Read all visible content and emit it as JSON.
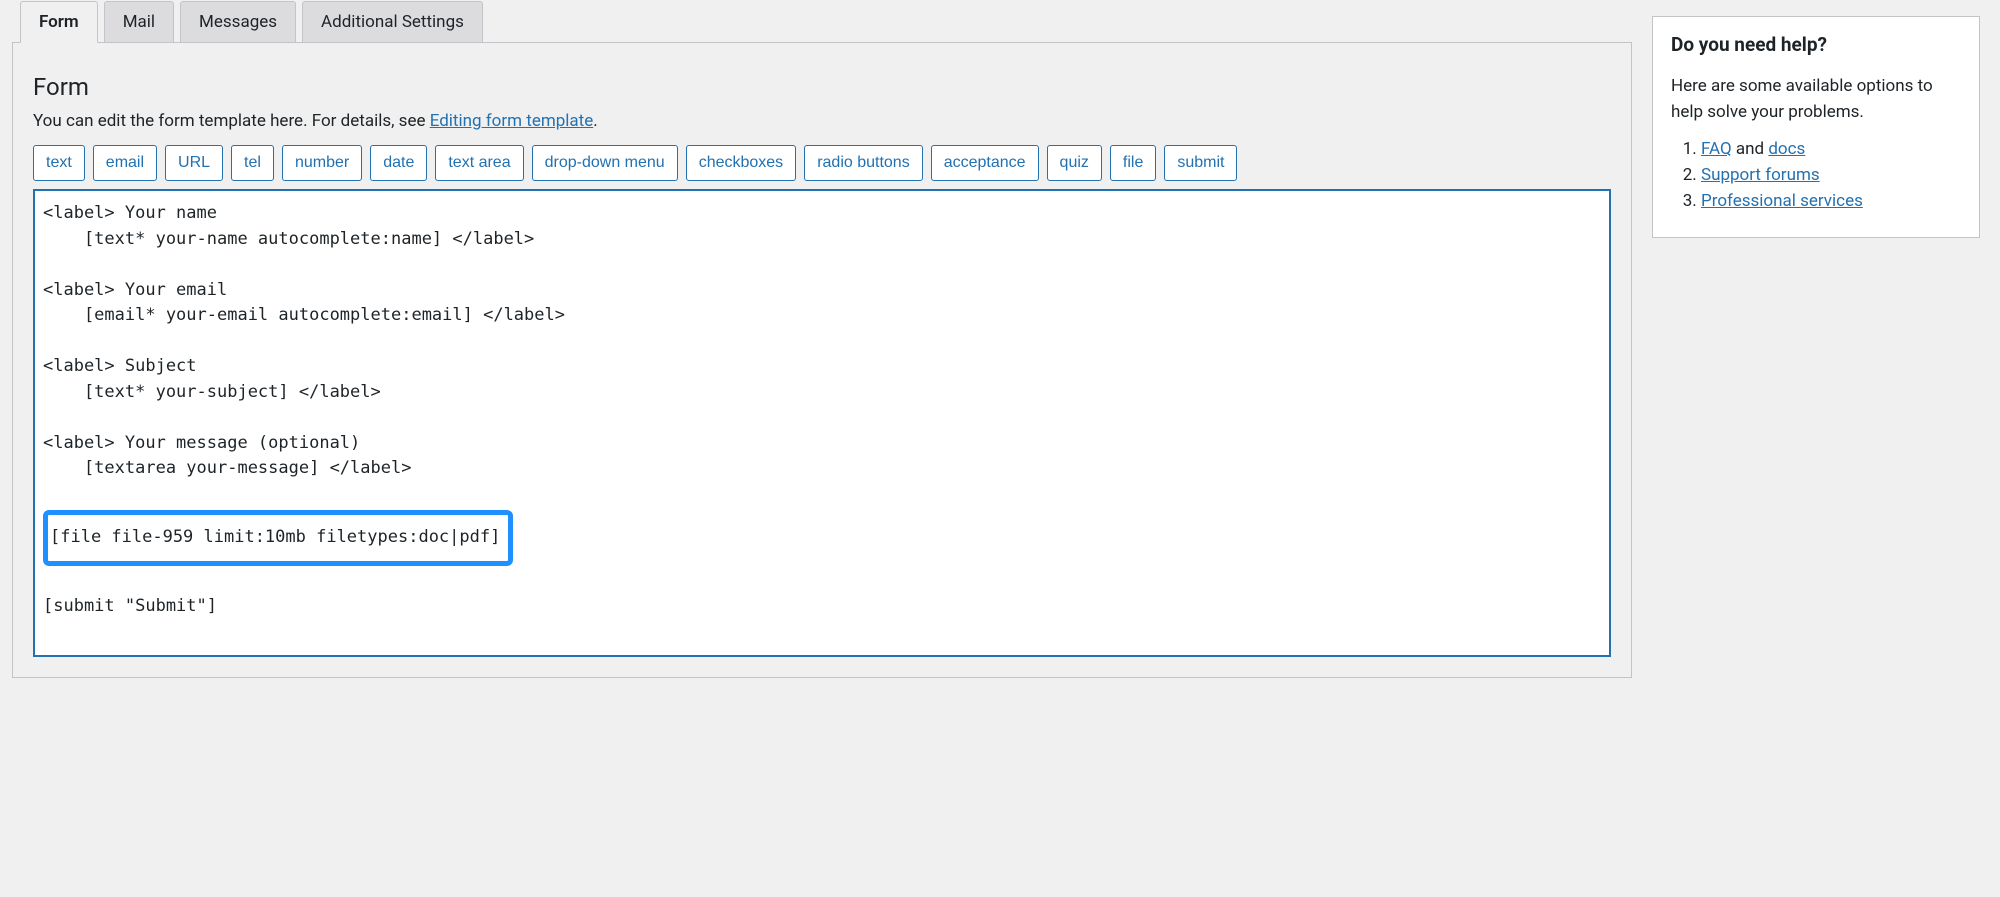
{
  "tabs": [
    {
      "label": "Form",
      "active": true
    },
    {
      "label": "Mail",
      "active": false
    },
    {
      "label": "Messages",
      "active": false
    },
    {
      "label": "Additional Settings",
      "active": false
    }
  ],
  "panel": {
    "heading": "Form",
    "desc_prefix": "You can edit the form template here. For details, see ",
    "desc_link": "Editing form template",
    "desc_suffix": "."
  },
  "tag_buttons": [
    "text",
    "email",
    "URL",
    "tel",
    "number",
    "date",
    "text area",
    "drop-down menu",
    "checkboxes",
    "radio buttons",
    "acceptance",
    "quiz",
    "file",
    "submit"
  ],
  "code_lines": [
    "<label> Your name",
    "    [text* your-name autocomplete:name] </label>",
    "",
    "<label> Your email",
    "    [email* your-email autocomplete:email] </label>",
    "",
    "<label> Subject",
    "    [text* your-subject] </label>",
    "",
    "<label> Your message (optional)",
    "    [textarea your-message] </label>",
    ""
  ],
  "code_highlight_line": "[file file-959 limit:10mb filetypes:doc|pdf]",
  "code_lines_after": [
    "",
    "[submit \"Submit\"]",
    ""
  ],
  "help": {
    "title": "Do you need help?",
    "intro": "Here are some available options to help solve your problems.",
    "items": [
      {
        "link1": "FAQ",
        "mid": " and ",
        "link2": "docs"
      },
      {
        "link1": "Support forums"
      },
      {
        "link1": "Professional services"
      }
    ]
  }
}
